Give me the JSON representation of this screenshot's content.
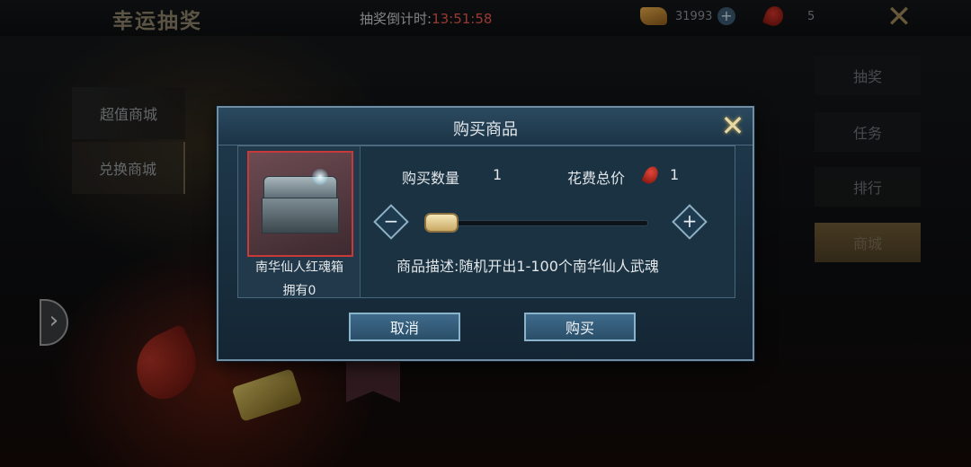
{
  "header": {
    "title": "幸运抽奖",
    "countdown_label": "抽奖倒计时:",
    "countdown_time": "13:51:58",
    "gold_amount": "31993",
    "gold_add": "+",
    "pepper_amount": "5",
    "close": "✕"
  },
  "left_tabs": [
    {
      "label": "超值商城"
    },
    {
      "label": "兑换商城"
    }
  ],
  "right_tabs": [
    {
      "label": "抽奖"
    },
    {
      "label": "任务"
    },
    {
      "label": "排行"
    },
    {
      "label": "商城"
    }
  ],
  "side_arrow": "›",
  "dialog": {
    "title": "购买商品",
    "close": "✕",
    "item_name": "南华仙人红魂箱",
    "owned": "拥有0",
    "quantity_label": "购买数量",
    "quantity_value": "1",
    "cost_label": "花费总价",
    "cost_value": "1",
    "minus": "−",
    "plus": "+",
    "slider_fraction": 0.0,
    "description": "商品描述:随机开出1-100个南华仙人武魂",
    "cancel_label": "取消",
    "buy_label": "购买"
  },
  "colors": {
    "countdown_time": "#e85a4e",
    "dialog_bg": "#1f3a4d",
    "item_frame_border": "#c83a3a",
    "active_right_tab": "#6e5a36"
  },
  "icons": {
    "gold": "gold-ingot-icon",
    "pepper": "red-pepper-icon",
    "chest": "treasure-chest-icon"
  }
}
